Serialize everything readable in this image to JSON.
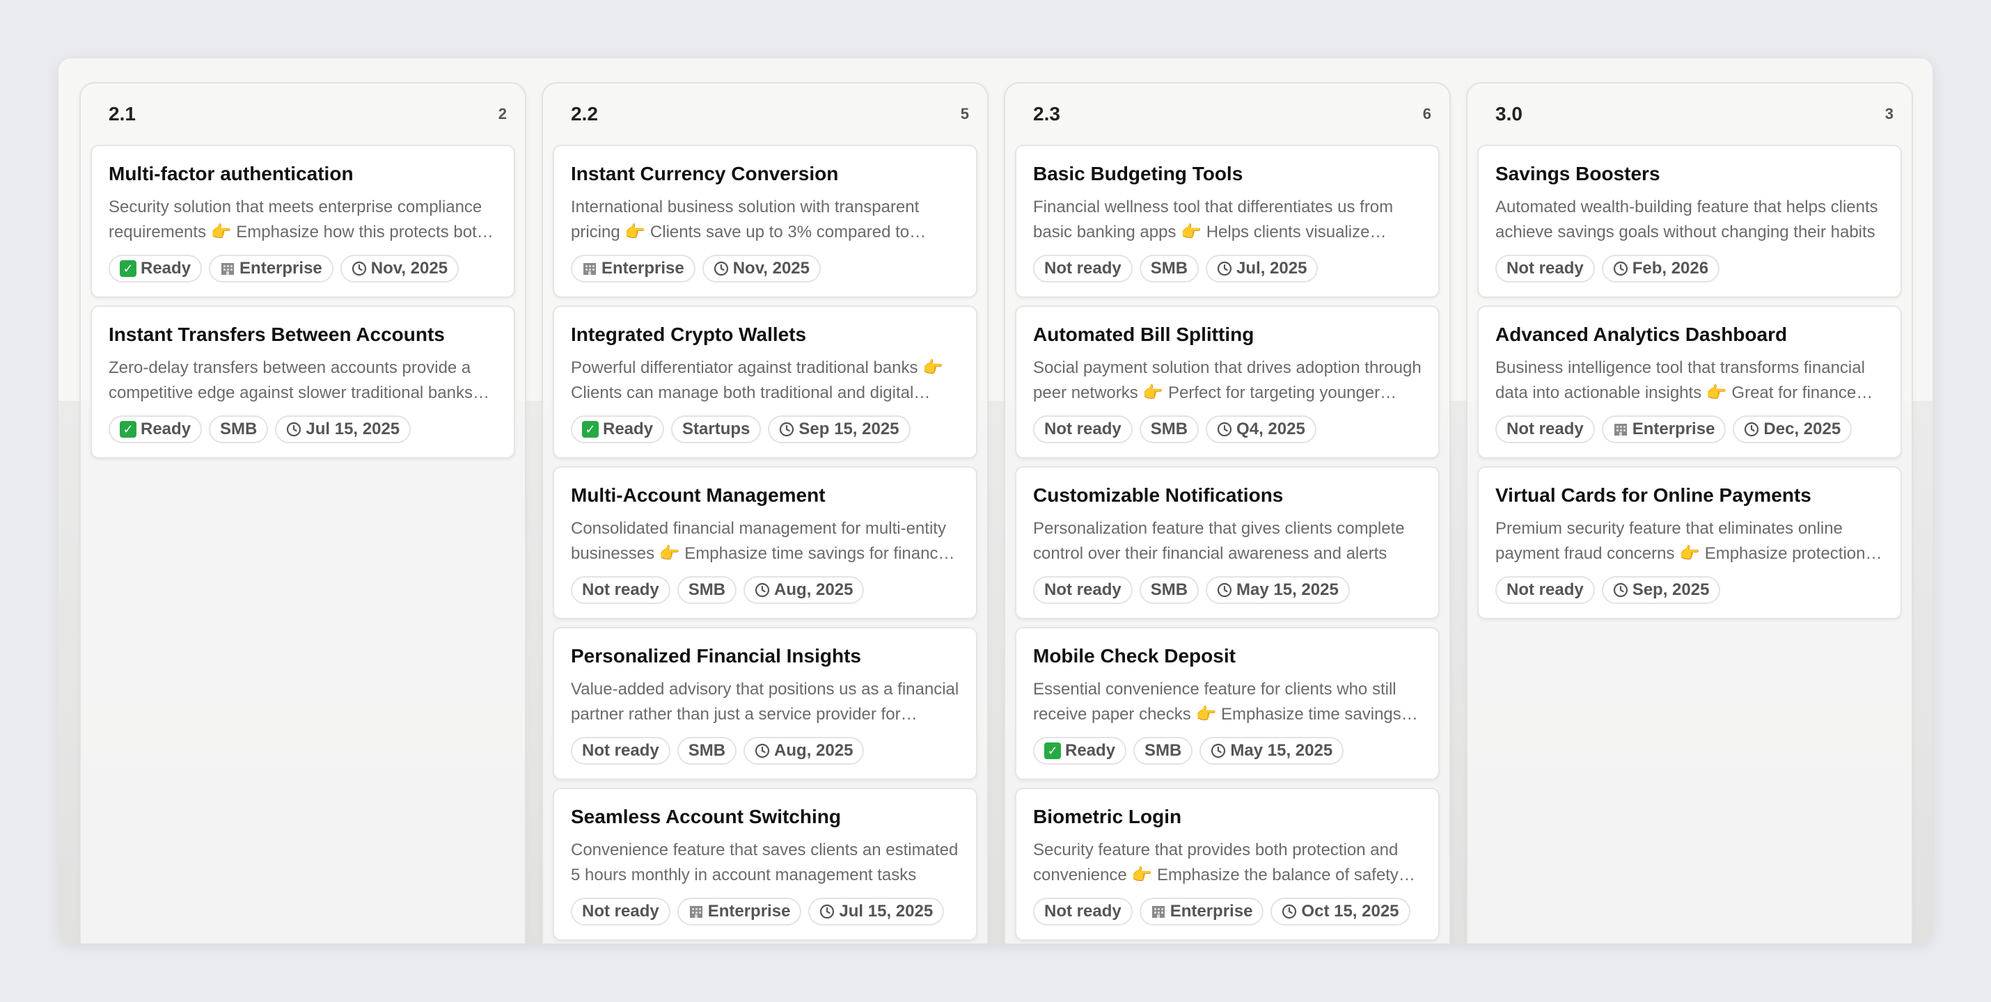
{
  "columns": [
    {
      "title": "2.1",
      "count": "2",
      "cards": [
        {
          "title": "Multi-factor authentication",
          "desc": "Security solution that meets enterprise compliance requirements 👉 Emphasize how this protects both client and customer data",
          "status": "Ready",
          "ready": true,
          "segment": "Enterprise",
          "segment_icon": "building",
          "date": "Nov, 2025"
        },
        {
          "title": "Instant Transfers Between Accounts",
          "desc": "Zero-delay transfers between accounts provide a competitive edge against slower traditional banks and improve cash flow",
          "status": "Ready",
          "ready": true,
          "segment": "SMB",
          "segment_icon": "",
          "date": "Jul 15, 2025"
        }
      ]
    },
    {
      "title": "2.2",
      "count": "5",
      "cards": [
        {
          "title": "Instant Currency Conversion",
          "desc": "International business solution with transparent pricing 👉 Clients save up to 3% compared to traditional banks",
          "status": "",
          "ready": false,
          "segment": "Enterprise",
          "segment_icon": "building",
          "date": "Nov, 2025"
        },
        {
          "title": "Integrated Crypto Wallets",
          "desc": "Powerful differentiator against traditional banks 👉 Clients can manage both traditional and digital assets in one place",
          "status": "Ready",
          "ready": true,
          "segment": "Startups",
          "segment_icon": "",
          "date": "Sep 15, 2025"
        },
        {
          "title": "Multi-Account Management",
          "desc": "Consolidated financial management for multi-entity businesses 👉 Emphasize time savings for finance teams",
          "status": "Not ready",
          "ready": false,
          "segment": "SMB",
          "segment_icon": "",
          "date": "Aug, 2025"
        },
        {
          "title": "Personalized Financial Insights",
          "desc": "Value-added advisory that positions us as a financial partner rather than just a service provider for growing businesses",
          "status": "Not ready",
          "ready": false,
          "segment": "SMB",
          "segment_icon": "",
          "date": "Aug, 2025"
        },
        {
          "title": "Seamless Account Switching",
          "desc": "Convenience feature that saves clients an estimated 5 hours monthly in account management tasks",
          "status": "Not ready",
          "ready": false,
          "segment": "Enterprise",
          "segment_icon": "building",
          "date": "Jul 15, 2025"
        }
      ]
    },
    {
      "title": "2.3",
      "count": "6",
      "cards": [
        {
          "title": "Basic Budgeting Tools",
          "desc": "Financial wellness tool that differentiates us from basic banking apps 👉 Helps clients visualize spending patterns",
          "status": "Not ready",
          "ready": false,
          "segment": "SMB",
          "segment_icon": "",
          "date": "Jul, 2025"
        },
        {
          "title": "Automated Bill Splitting",
          "desc": "Social payment solution that drives adoption through peer networks 👉 Perfect for targeting younger demographics",
          "status": "Not ready",
          "ready": false,
          "segment": "SMB",
          "segment_icon": "",
          "date": "Q4, 2025"
        },
        {
          "title": "Customizable Notifications",
          "desc": "Personalization feature that gives clients complete control over their financial awareness and alerts",
          "status": "Not ready",
          "ready": false,
          "segment": "SMB",
          "segment_icon": "",
          "date": "May 15, 2025"
        },
        {
          "title": "Mobile Check Deposit",
          "desc": "Essential convenience feature for clients who still receive paper checks 👉 Emphasize time savings versus branch visits",
          "status": "Ready",
          "ready": true,
          "segment": "SMB",
          "segment_icon": "",
          "date": "May 15, 2025"
        },
        {
          "title": "Biometric Login",
          "desc": "Security feature that provides both protection and convenience 👉 Emphasize the balance of safety and speed",
          "status": "Not ready",
          "ready": false,
          "segment": "Enterprise",
          "segment_icon": "building",
          "date": "Oct 15, 2025"
        }
      ]
    },
    {
      "title": "3.0",
      "count": "3",
      "cards": [
        {
          "title": "Savings Boosters",
          "desc": "Automated wealth-building feature that helps clients achieve savings goals without changing their habits",
          "status": "Not ready",
          "ready": false,
          "segment": "",
          "segment_icon": "",
          "date": "Feb, 2026"
        },
        {
          "title": "Advanced Analytics Dashboard",
          "desc": "Business intelligence tool that transforms financial data into actionable insights 👉 Great for finance leaders",
          "status": "Not ready",
          "ready": false,
          "segment": "Enterprise",
          "segment_icon": "building",
          "date": "Dec, 2025"
        },
        {
          "title": "Virtual Cards for Online Payments",
          "desc": "Premium security feature that eliminates online payment fraud concerns 👉 Emphasize protection for online purchases",
          "status": "Not ready",
          "ready": false,
          "segment": "",
          "segment_icon": "",
          "date": "Sep, 2025"
        }
      ]
    }
  ]
}
